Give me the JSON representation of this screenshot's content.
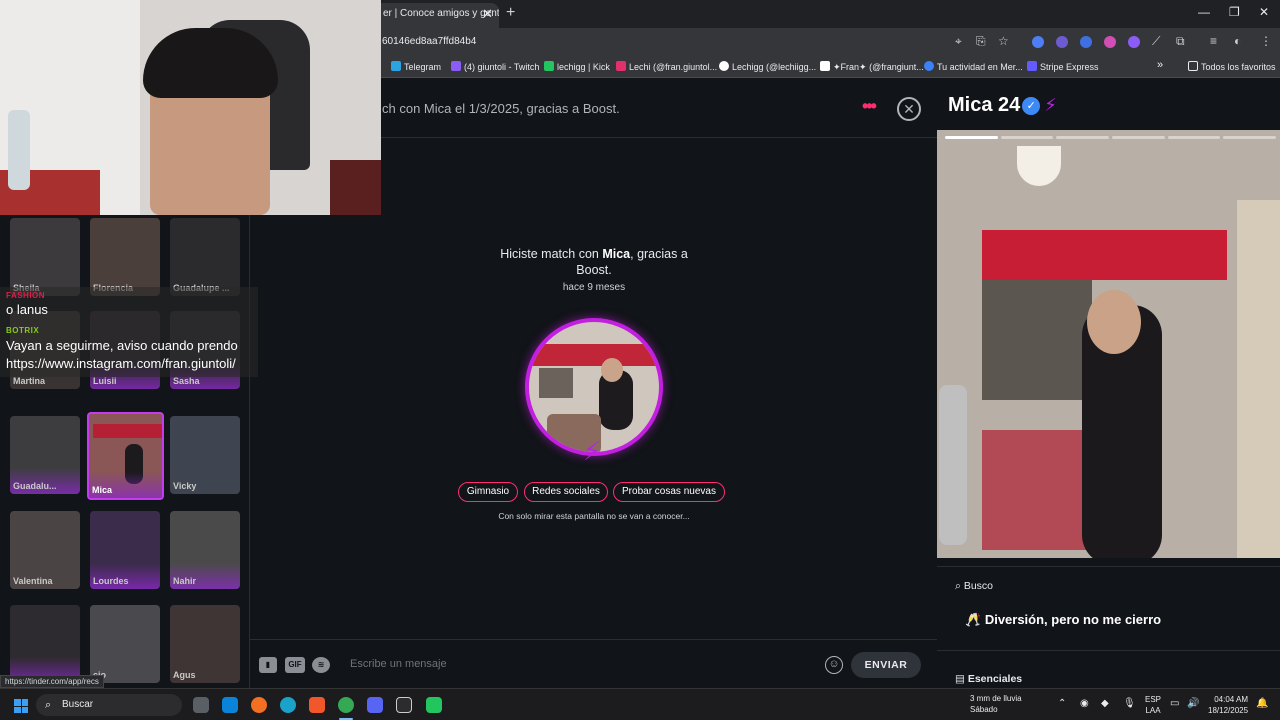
{
  "browser": {
    "tab_title": "er | Conoce amigos y gente",
    "url": "60146ed8aa7ffd84b4",
    "bookmarks": [
      {
        "label": "Telegram",
        "color": "#2aa3e0"
      },
      {
        "label": "(4) giuntoli - Twitch",
        "color": "#8b5cf6"
      },
      {
        "label": "lechigg | Kick",
        "color": "#22c55e"
      },
      {
        "label": "Lechi (@fran.giuntol...",
        "color": "#e1306c"
      },
      {
        "label": "Lechigg (@lechiigg...",
        "color": "#111111"
      },
      {
        "label": "✦Fran✦ (@frangiunt...",
        "color": "#000000"
      },
      {
        "label": "Tu actividad en Mer...",
        "color": "#3b82f6"
      },
      {
        "label": "Stripe Express",
        "color": "#635bff"
      }
    ],
    "all_bookmarks": "Todos los favoritos"
  },
  "candidates": [
    {
      "name": "Sheila",
      "bg": "#3c3a3d"
    },
    {
      "name": "Florencia",
      "bg": "#4a3f3b"
    },
    {
      "name": "Guadalupe ...",
      "bg": "#2b2a2c"
    },
    {
      "name": "Martina",
      "bg": "#3a3334"
    },
    {
      "name": "Luisii",
      "bg": "#2f2a31"
    },
    {
      "name": "Sasha",
      "bg": "#2e2a2f"
    },
    {
      "name": "Guadalu...",
      "bg": "#3d3d40"
    },
    {
      "name": "Mica",
      "bg": "#8a5656"
    },
    {
      "name": "Vicky",
      "bg": "#3f4550"
    },
    {
      "name": "Valentina",
      "bg": "#4a4444"
    },
    {
      "name": "Lourdes",
      "bg": "#3a2c4a"
    },
    {
      "name": "Nahir",
      "bg": "#4b4a4a"
    },
    {
      "name": "",
      "bg": "#2e2b30"
    },
    {
      "name": "cio",
      "bg": "#4a4a4e"
    },
    {
      "name": "Agus",
      "bg": "#3e3534"
    }
  ],
  "stream_chat": [
    {
      "user": "FASHION",
      "user_color": "#e11d48",
      "text": "o lanus"
    },
    {
      "user": "BOTRIX",
      "user_color": "#84cc16",
      "text": "Vayan a seguirme, aviso cuando prendo"
    },
    {
      "user": "",
      "user_color": "#ffffff",
      "text": "https://www.instagram.com/fran.giuntoli/"
    }
  ],
  "chat": {
    "header": "ch con Mica el 1/3/2025, gracias a Boost.",
    "match_prefix": "Hiciste match con ",
    "match_name": "Mica",
    "match_suffix": ", gracias a Boost.",
    "match_time": "hace 9 meses",
    "interests": [
      "Gimnasio",
      "Redes sociales",
      "Probar cosas nuevas"
    ],
    "note": "Con solo mirar esta pantalla no se van a conocer...",
    "composer_placeholder": "Escribe un mensaje",
    "gif_label": "GIF",
    "send_label": "ENVIAR"
  },
  "profile": {
    "name": "Mica",
    "age": "24",
    "looking_for_label": "Busco",
    "looking_for_value": "Diversión, pero no me cierro",
    "essentials_label": "Esenciales"
  },
  "status_url": "https://tinder.com/app/recs",
  "taskbar": {
    "search_label": "Buscar",
    "weather_line1": "3 mm de lluvia",
    "weather_line2": "Sábado",
    "lang_line1": "ESP",
    "lang_line2": "LAA",
    "time": "04:04 AM",
    "date": "18/12/2025"
  },
  "colors": {
    "accent": "#ff2d6f",
    "boost": "#b526e0",
    "verified": "#3d8af7"
  }
}
